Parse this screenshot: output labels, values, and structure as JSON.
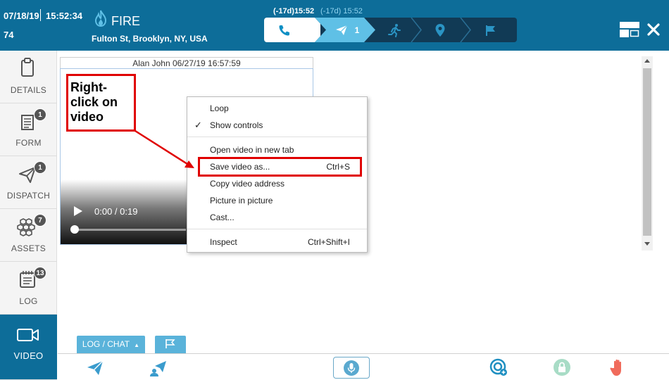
{
  "header": {
    "date": "07/18/19",
    "time": "15:52:34",
    "incident_number": "74",
    "incident_type": "FIRE",
    "address": "Fulton St, Brooklyn, NY, USA",
    "timer_active": "(-17d)15:52",
    "timer_secondary": "(-17d) 15:52",
    "steps": [
      {
        "icon": "phone-icon",
        "count": ""
      },
      {
        "icon": "paper-plane-icon",
        "count": "1"
      },
      {
        "icon": "running-person-icon",
        "count": ""
      },
      {
        "icon": "map-pin-icon",
        "count": ""
      },
      {
        "icon": "flag-icon",
        "count": ""
      }
    ]
  },
  "sidebar": {
    "items": [
      {
        "label": "DETAILS",
        "badge": "",
        "icon": "clipboard-icon"
      },
      {
        "label": "FORM",
        "badge": "1",
        "icon": "form-icon"
      },
      {
        "label": "DISPATCH",
        "badge": "1",
        "icon": "paper-plane-icon"
      },
      {
        "label": "ASSETS",
        "badge": "7",
        "icon": "hexagons-icon"
      },
      {
        "label": "LOG",
        "badge": "13",
        "icon": "log-icon"
      },
      {
        "label": "VIDEO",
        "badge": "",
        "icon": "video-camera-icon"
      }
    ]
  },
  "video": {
    "caption": "Alan John 06/27/19 16:57:59",
    "time": "0:00 / 0:19",
    "progress": 0
  },
  "context_menu": {
    "items": [
      {
        "label": "Loop",
        "shortcut": "",
        "checked": false
      },
      {
        "label": "Show controls",
        "shortcut": "",
        "checked": true
      },
      {
        "label": "Open video in new tab",
        "shortcut": ""
      },
      {
        "label": "Save video as...",
        "shortcut": "Ctrl+S"
      },
      {
        "label": "Copy video address",
        "shortcut": ""
      },
      {
        "label": "Picture in picture",
        "shortcut": ""
      },
      {
        "label": "Cast...",
        "shortcut": ""
      },
      {
        "label": "Inspect",
        "shortcut": "Ctrl+Shift+I"
      }
    ]
  },
  "annotation": {
    "lines": [
      "Right-",
      "click on",
      "video"
    ]
  },
  "bottom": {
    "log_chat_label": "LOG / CHAT",
    "tools": [
      "dispatch-send-icon",
      "dispatch-group-icon",
      "microphone-icon",
      "target-icon",
      "lock-icon",
      "hand-stop-icon"
    ]
  },
  "colors": {
    "header": "#0d6d99",
    "active_nav": "#0d6d99",
    "accent_light": "#5ab3da",
    "annotation_red": "#e00000"
  }
}
